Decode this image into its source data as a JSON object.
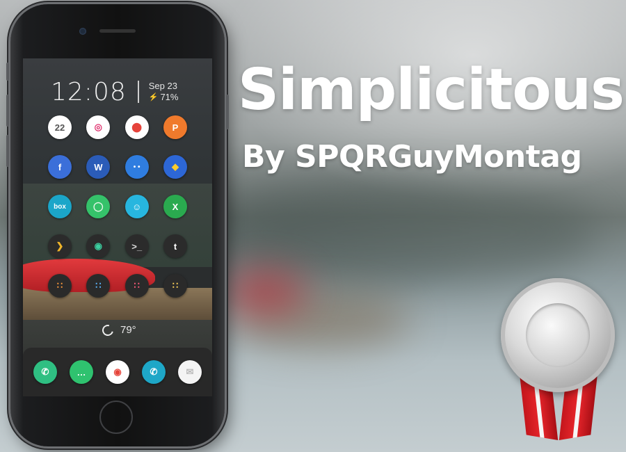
{
  "lockscreen": {
    "time": "12:08",
    "date": "Sep 23",
    "battery": "71%"
  },
  "apps": [
    [
      {
        "name": "calendar-app-icon",
        "glyph": "22",
        "bg": "#ffffff",
        "fg": "#555555"
      },
      {
        "name": "itunes-app-icon",
        "glyph": "◎",
        "bg": "#ffffff",
        "fg": "#e0336f"
      },
      {
        "name": "maps-app-icon",
        "glyph": "⬤",
        "bg": "#ffffff",
        "fg": "#e6433b"
      },
      {
        "name": "powerpoint-app-icon",
        "glyph": "P",
        "bg": "#f07a2c",
        "fg": "#ffffff"
      }
    ],
    [
      {
        "name": "facebook-app-icon",
        "glyph": "f",
        "bg": "#3b6fd9",
        "fg": "#ffffff"
      },
      {
        "name": "word-app-icon",
        "glyph": "W",
        "bg": "#2b5cb8",
        "fg": "#ffffff"
      },
      {
        "name": "finder-app-icon",
        "glyph": "• •",
        "bg": "#2f7de0",
        "fg": "#ffffff"
      },
      {
        "name": "pocket-app-icon",
        "glyph": "◆",
        "bg": "#2d67d6",
        "fg": "#ffcc2b"
      }
    ],
    [
      {
        "name": "box-app-icon",
        "glyph": "box",
        "bg": "#1ba6c9",
        "fg": "#ffffff"
      },
      {
        "name": "find-friends-app-icon",
        "glyph": "◯",
        "bg": "#35c26a",
        "fg": "#e8f6ea"
      },
      {
        "name": "waze-app-icon",
        "glyph": "☺",
        "bg": "#27b6df",
        "fg": "#ffffff"
      },
      {
        "name": "excel-app-icon",
        "glyph": "X",
        "bg": "#2aaa4f",
        "fg": "#ffffff"
      }
    ],
    [
      {
        "name": "plex-app-icon",
        "glyph": "❯",
        "bg": "#2b2b2b",
        "fg": "#f0b52a"
      },
      {
        "name": "vine-app-icon",
        "glyph": "◉",
        "bg": "#2b2b2b",
        "fg": "#3ccfa0"
      },
      {
        "name": "terminal-app-icon",
        "glyph": ">_",
        "bg": "#2b2b2b",
        "fg": "#dcdcdc"
      },
      {
        "name": "tumblr-app-icon",
        "glyph": "t",
        "bg": "#2b2b2b",
        "fg": "#ffffff"
      }
    ],
    [
      {
        "name": "folder-app-icon-1",
        "glyph": "∷",
        "bg": "#2a2a2a",
        "fg": "#ff9a3c"
      },
      {
        "name": "folder-app-icon-2",
        "glyph": "∷",
        "bg": "#2a2a2a",
        "fg": "#5cb7ff"
      },
      {
        "name": "folder-app-icon-3",
        "glyph": "∷",
        "bg": "#2a2a2a",
        "fg": "#ff5a7a"
      },
      {
        "name": "folder-app-icon-4",
        "glyph": "∷",
        "bg": "#2a2a2a",
        "fg": "#ffd35a"
      }
    ]
  ],
  "weather": {
    "temp": "79°"
  },
  "dock": [
    {
      "name": "phone-app-icon",
      "glyph": "✆",
      "bg": "#2fbf82",
      "fg": "#ffffff"
    },
    {
      "name": "messages-app-icon",
      "glyph": "…",
      "bg": "#2fc26f",
      "fg": "#ffffff"
    },
    {
      "name": "chrome-app-icon",
      "glyph": "◉",
      "bg": "#ffffff",
      "fg": "#e6443a"
    },
    {
      "name": "contacts-app-icon",
      "glyph": "✆",
      "bg": "#1ea7c7",
      "fg": "#ffffff"
    },
    {
      "name": "mail-app-icon",
      "glyph": "✉",
      "bg": "#f4f4f4",
      "fg": "#bbbbbb"
    }
  ],
  "banner": {
    "title": "Simplicitous",
    "byline": "By SPQRGuyMontag"
  }
}
